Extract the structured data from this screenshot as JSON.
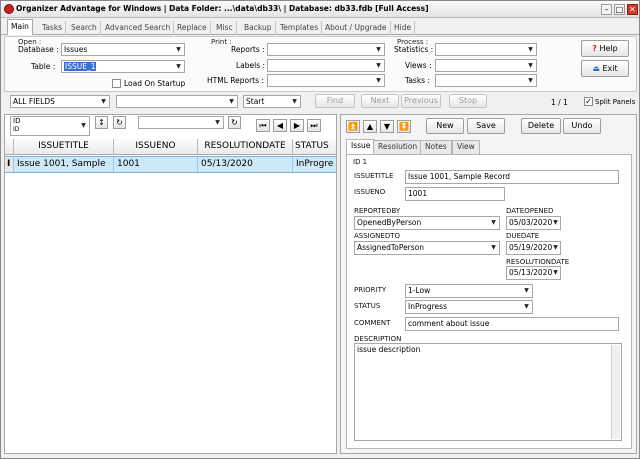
{
  "window": {
    "title": "Organizer Advantage for Windows | Data Folder: ...\\data\\db33\\ | Database: db33.fdb [Full Access]",
    "minimize_glyph": "–",
    "maximize_glyph": "□",
    "close_glyph": "✕"
  },
  "tabs": [
    "Main",
    "Tasks",
    "Search",
    "Advanced Search",
    "Replace",
    "Misc",
    "Backup",
    "Templates",
    "About / Upgrade",
    "Hide"
  ],
  "open_group": {
    "title": "Open :",
    "database_label": "Database :",
    "database_value": "Issues",
    "table_label": "Table :",
    "table_value": "ISSUE_1",
    "load_on_startup_label": "Load On Startup"
  },
  "print_group": {
    "title": "Print :",
    "reports_label": "Reports :",
    "labels_label": "Labels :",
    "html_reports_label": "HTML Reports :"
  },
  "process_group": {
    "title": "Process :",
    "statistics_label": "Statistics :",
    "views_label": "Views :",
    "tasks_label": "Tasks :"
  },
  "help_button": "Help",
  "exit_button": "Exit",
  "search_bar": {
    "field_value": "ALL FIELDS",
    "search_value": "",
    "mode_value": "Start",
    "find_label": "Find",
    "next_label": "Next",
    "previous_label": "Previous",
    "stop_label": "Stop",
    "record_count": "1 / 1",
    "split_panels_label": "Split Panels"
  },
  "sort_bar": {
    "sort_field": "ID",
    "sort_sub": "ID",
    "sort_dir": "↕",
    "refresh_glyph": "↻",
    "filter_value": "",
    "nav": [
      "⏮",
      "◀",
      "▶",
      "⏭"
    ]
  },
  "grid": {
    "columns": [
      "ISSUETITLE",
      "ISSUENO",
      "RESOLUTIONDATE",
      "STATUS"
    ],
    "rows": [
      {
        "marker": "I",
        "ISSUETITLE": "Issue 1001, Sample",
        "ISSUENO": "1001",
        "RESOLUTIONDATE": "05/13/2020",
        "STATUS": "InProgre"
      }
    ]
  },
  "record_toolbar": {
    "nav": [
      "⏫",
      "▲",
      "▼",
      "⏬"
    ],
    "new_label": "New",
    "save_label": "Save",
    "delete_label": "Delete",
    "undo_label": "Undo"
  },
  "detail_tabs": [
    "Issue",
    "Resolution",
    "Notes",
    "View"
  ],
  "record": {
    "id_label": "ID 1",
    "issuetitle_label": "ISSUETITLE",
    "issuetitle_value": "Issue 1001, Sample Record",
    "issueno_label": "ISSUENO",
    "issueno_value": "1001",
    "reportedby_label": "REPORTEDBY",
    "reportedby_value": "OpenedByPerson",
    "dateopened_label": "DATEOPENED",
    "dateopened_value": "05/03/2020",
    "assignedto_label": "ASSIGNEDTO",
    "assignedto_value": "AssignedToPerson",
    "duedate_label": "DUEDATE",
    "duedate_value": "05/19/2020",
    "resolutiondate_label": "RESOLUTIONDATE",
    "resolutiondate_value": "05/13/2020",
    "priority_label": "PRIORITY",
    "priority_value": "1-Low",
    "status_label": "STATUS",
    "status_value": "InProgress",
    "comment_label": "COMMENT",
    "comment_value": "comment about issue",
    "description_label": "DESCRIPTION",
    "description_value": "issue description"
  },
  "colors": {
    "selection": "#3a6fd2",
    "row_highlight": "#cde8f7",
    "close_button": "#d23a2c"
  }
}
